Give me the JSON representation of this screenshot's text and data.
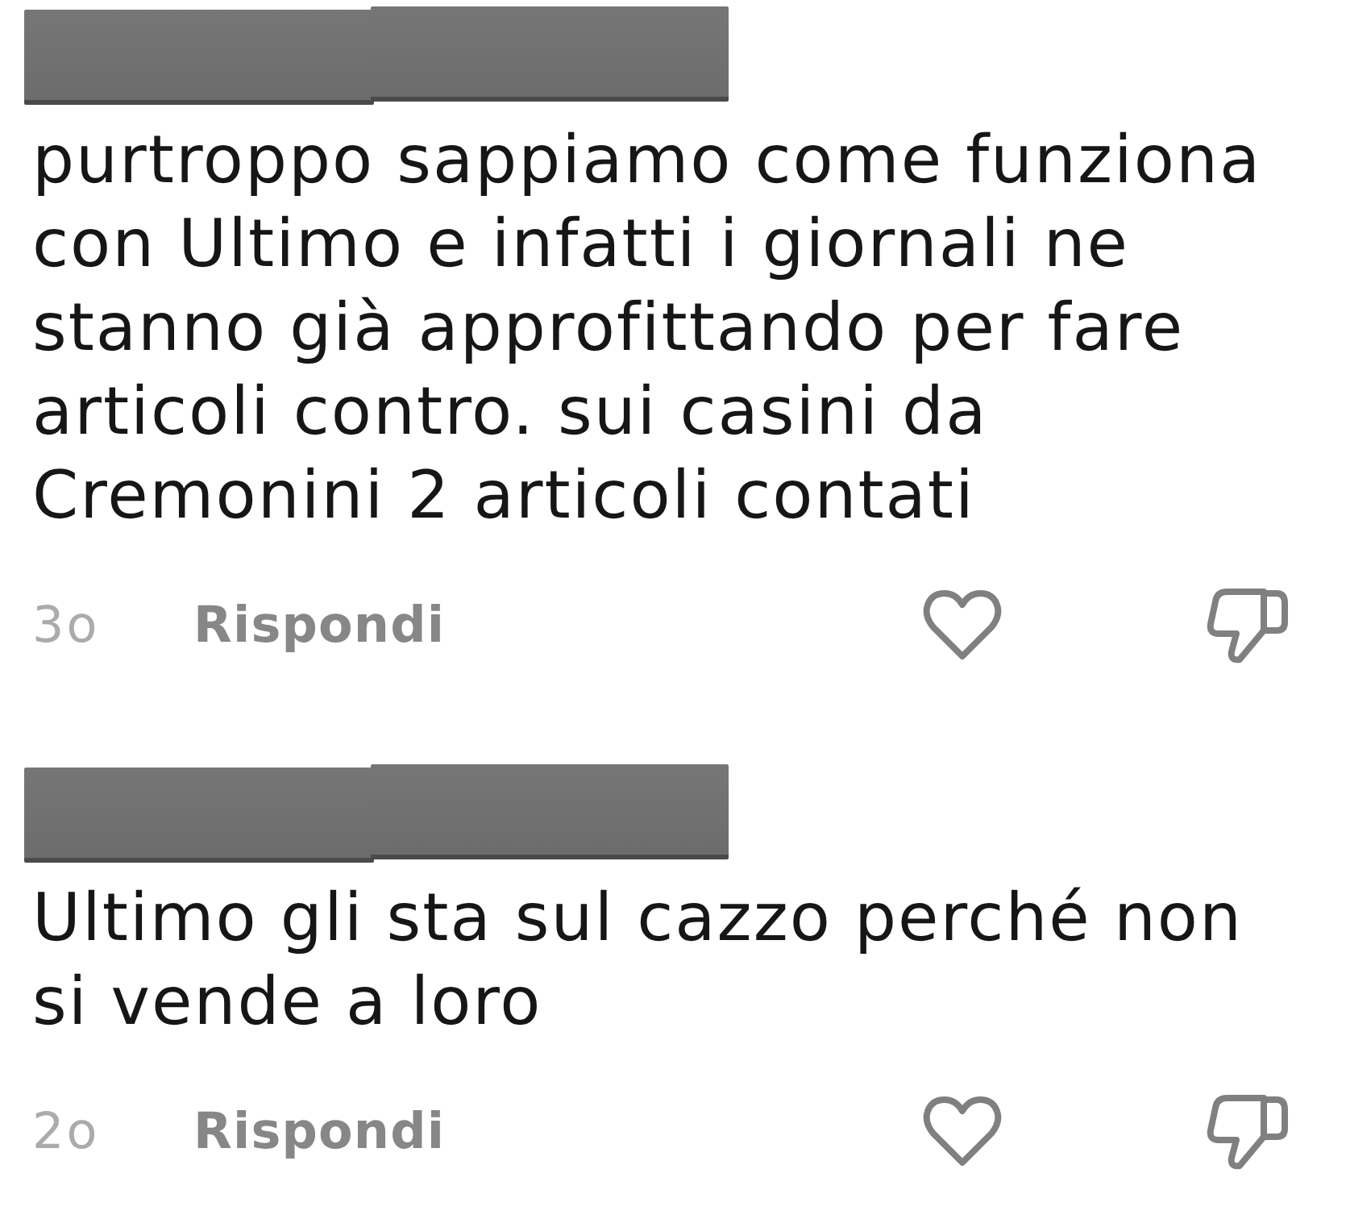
{
  "comments": [
    {
      "text": "purtroppo sappiamo come funziona con Ultimo e infatti i giornali ne stanno già approfittando per fare articoli contro. sui casini da Cremonini 2 articoli contati",
      "time": "3o",
      "reply_label": "Rispondi"
    },
    {
      "text": "Ultimo gli sta sul cazzo perché non si vende a loro",
      "time": "2o",
      "reply_label": "Rispondi"
    }
  ]
}
